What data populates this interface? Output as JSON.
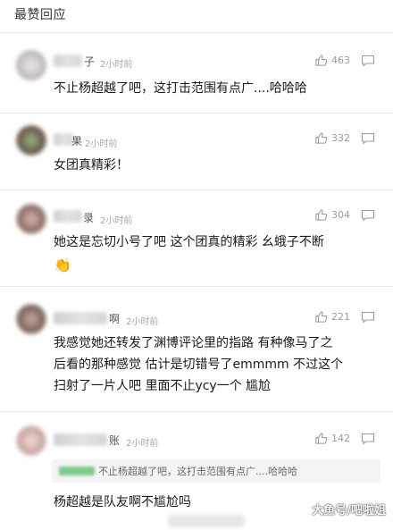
{
  "header": {
    "title": "最赞回应"
  },
  "comments": [
    {
      "name_suffix": "子",
      "time": "2小时前",
      "likes": "463",
      "text": "不止杨超越了吧，这打击范围有点广....哈哈哈"
    },
    {
      "name_suffix": "果",
      "time": "2小时前",
      "likes": "332",
      "text": "女团真精彩！"
    },
    {
      "name_suffix": "录",
      "time": "2小时前",
      "likes": "304",
      "text": "她这是忘切小号了吧 这个团真的精彩 幺蛾子不断",
      "emoji": "👏"
    },
    {
      "name_suffix": "啊",
      "time": "2小时前",
      "likes": "221",
      "text_lines": [
        "我感觉她还转发了渊博评论里的指路 有种像马了之",
        "后看的那种感觉 估计是切错号了emmmm 不过这个",
        "扫射了一片人吧 里面不止ycy一个 尴尬"
      ]
    },
    {
      "name_suffix": "账",
      "time": "2小时前",
      "likes": "142",
      "quote": "不止杨超越了吧，这打击范围有点广....哈哈哈",
      "text": "杨超越是队友啊不尴尬吗"
    }
  ],
  "watermark": "大鱼号/吧啦姐",
  "colors": {
    "background": "#ffffff",
    "text": "#1a1a1a",
    "meta": "#a8a8a8",
    "quote_bg": "#f4f4f4",
    "quote_tag": "#7fc98a"
  },
  "icons": {
    "like": "thumbs-up-icon",
    "reply": "comment-bubble-icon"
  }
}
